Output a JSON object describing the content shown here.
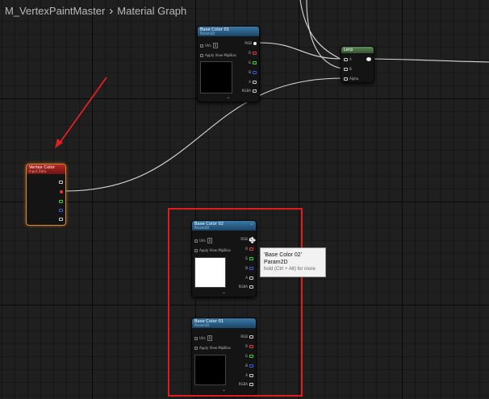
{
  "breadcrumb": {
    "asset": "M_VertexPaintMaster",
    "separator": "›",
    "graph": "Material Graph"
  },
  "nodes": {
    "base_color_top": {
      "title": "Base Color 01",
      "subtitle": "Param2D",
      "uvs_label": "UVs",
      "uvs_value": "0",
      "mip_label": "Apply View MipBias",
      "preview_color": "#000000",
      "pins": [
        "RGB",
        "R",
        "G",
        "B",
        "A",
        "RGBA"
      ]
    },
    "lerp": {
      "title": "Lerp",
      "pins": [
        "A",
        "B",
        "Alpha"
      ]
    },
    "vertex_color": {
      "title": "Vertex Color",
      "subtitle": "Input Data"
    },
    "base_color_02": {
      "title": "Base Color 02",
      "subtitle": "Param2D",
      "uvs_label": "UVs",
      "uvs_value": "0",
      "mip_label": "Apply View MipBias",
      "preview_color": "#ffffff",
      "pins": [
        "RGB",
        "R",
        "G",
        "B",
        "A",
        "RGBA"
      ]
    },
    "base_color_bottom": {
      "title": "Base Color 01",
      "subtitle": "Param2D",
      "uvs_label": "UVs",
      "uvs_value": "0",
      "mip_label": "Apply View MipBias",
      "preview_color": "#000000",
      "pins": [
        "RGB",
        "R",
        "G",
        "B",
        "A",
        "RGBA"
      ]
    }
  },
  "tooltip": {
    "line1": "'Base Color 02'",
    "line2": "Param2D",
    "hint": "hold (Ctrl + Alt) for more"
  },
  "colors": {
    "pin_r": "#e03a3a",
    "pin_g": "#3ad03a",
    "pin_b": "#3a5ae0",
    "annotation_red": "#e11c1c",
    "wire": "#d8d8d8"
  },
  "icons": {
    "collapse": "chevron-up-icon",
    "expand": "chevron-down-icon",
    "cursor": "move-cursor-icon"
  }
}
